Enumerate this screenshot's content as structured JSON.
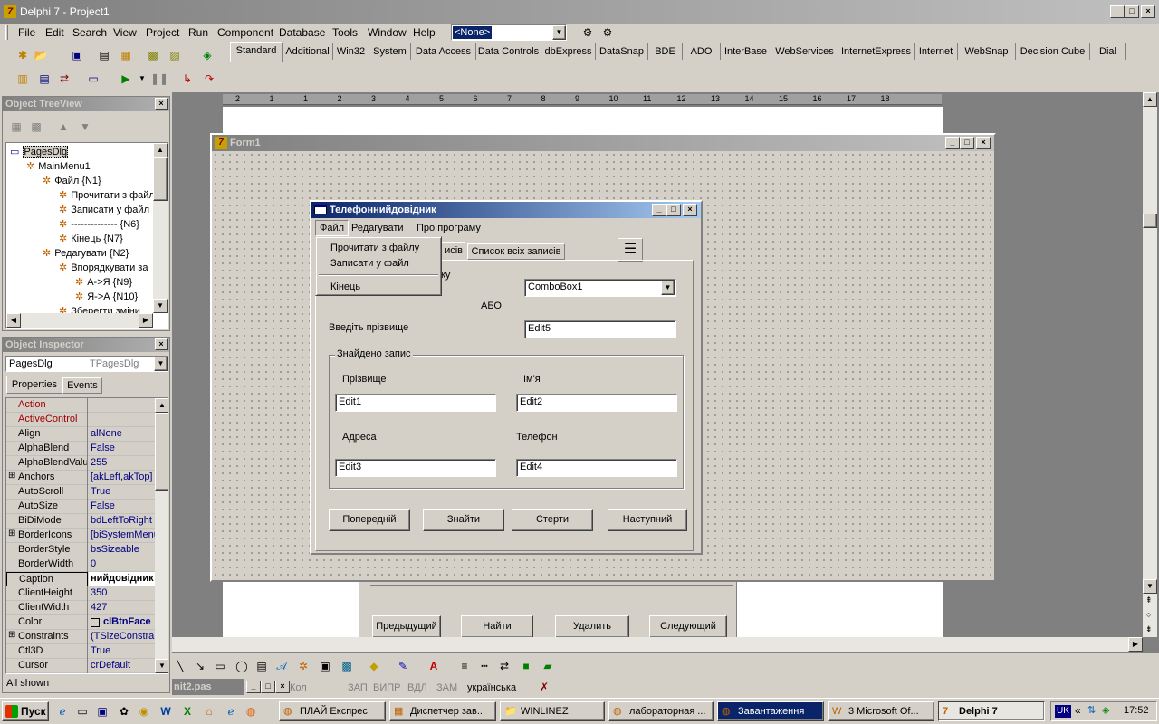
{
  "ide": {
    "title": "Delphi 7 - Project1",
    "menu": [
      "File",
      "Edit",
      "Search",
      "View",
      "Project",
      "Run",
      "Component",
      "Database",
      "Tools",
      "Window",
      "Help"
    ],
    "config_combo": "<None>",
    "palette_tabs": [
      "Standard",
      "Additional",
      "Win32",
      "System",
      "Data Access",
      "Data Controls",
      "dbExpress",
      "DataSnap",
      "BDE",
      "ADO",
      "InterBase",
      "WebServices",
      "InternetExpress",
      "Internet",
      "WebSnap",
      "Decision Cube",
      "Dial"
    ],
    "ruler_numbers": [
      "2",
      "1",
      "1",
      "2",
      "3",
      "4",
      "5",
      "6",
      "7",
      "8",
      "9",
      "10",
      "11",
      "12",
      "13",
      "14",
      "15",
      "16",
      "17",
      "18"
    ]
  },
  "treeview": {
    "title": "Object TreeView",
    "items": [
      {
        "label": "PagesDlg",
        "level": 0
      },
      {
        "label": "MainMenu1",
        "level": 1
      },
      {
        "label": "Файл {N1}",
        "level": 2
      },
      {
        "label": "Прочитати з файл",
        "level": 3
      },
      {
        "label": "Записати у файл",
        "level": 3
      },
      {
        "label": "-------------- {N6}",
        "level": 3
      },
      {
        "label": "Кінець {N7}",
        "level": 3
      },
      {
        "label": "Редагувати {N2}",
        "level": 2
      },
      {
        "label": "Впорядкувати за",
        "level": 3
      },
      {
        "label": "А->Я {N9}",
        "level": 4
      },
      {
        "label": "Я->А {N10}",
        "level": 4
      },
      {
        "label": "Зберегти зміни",
        "level": 3
      }
    ]
  },
  "inspector": {
    "title": "Object Inspector",
    "object_name": "PagesDlg",
    "object_type": "TPagesDlg",
    "tabs": [
      "Properties",
      "Events"
    ],
    "status": "All shown",
    "props": [
      {
        "name": "Action",
        "value": "",
        "red": true
      },
      {
        "name": "ActiveControl",
        "value": "",
        "red": true
      },
      {
        "name": "Align",
        "value": "alNone"
      },
      {
        "name": "AlphaBlend",
        "value": "False"
      },
      {
        "name": "AlphaBlendValu",
        "value": "255"
      },
      {
        "name": "Anchors",
        "value": "[akLeft,akTop]",
        "plus": true
      },
      {
        "name": "AutoScroll",
        "value": "True"
      },
      {
        "name": "AutoSize",
        "value": "False"
      },
      {
        "name": "BiDiMode",
        "value": "bdLeftToRight"
      },
      {
        "name": "BorderIcons",
        "value": "[biSystemMenu,",
        "plus": true
      },
      {
        "name": "BorderStyle",
        "value": "bsSizeable"
      },
      {
        "name": "BorderWidth",
        "value": "0"
      },
      {
        "name": "Caption",
        "value": "нийдовідник",
        "selected": true
      },
      {
        "name": "ClientHeight",
        "value": "350"
      },
      {
        "name": "ClientWidth",
        "value": "427"
      },
      {
        "name": "Color",
        "value": "clBtnFace",
        "bold": true
      },
      {
        "name": "Constraints",
        "value": "(TSizeConstraint",
        "plus": true
      },
      {
        "name": "Ctl3D",
        "value": "True"
      },
      {
        "name": "Cursor",
        "value": "crDefault"
      }
    ]
  },
  "form1": {
    "title": "Form1"
  },
  "dialog": {
    "title": "Телефоннийдовідник",
    "menu": [
      "Файл",
      "Редагувати",
      "Про програму"
    ],
    "file_menu": [
      "Прочитати з файлу",
      "Записати у файл",
      "Кінець"
    ],
    "tabs": [
      "исів",
      "Список всіх записів"
    ],
    "partial_label": "ку",
    "combo": "ComboBox1",
    "or_label": "АБО",
    "surname_prompt": "Введіть прізвище",
    "edit5": "Edit5",
    "group_title": "Знайдено запис",
    "lbl_surname": "Прізвище",
    "lbl_name": "Ім'я",
    "edit1": "Edit1",
    "edit2": "Edit2",
    "lbl_address": "Адреса",
    "lbl_phone": "Телефон",
    "edit3": "Edit3",
    "edit4": "Edit4",
    "buttons": [
      "Попередній",
      "Знайти",
      "Стерти",
      "Наступний"
    ]
  },
  "background_form": {
    "buttons": [
      "Предыдущий",
      "Найти",
      "Удалить",
      "Следующий"
    ]
  },
  "editor_status": {
    "tab": "nit2.pas",
    "col": "Кол",
    "items": [
      "ЗАП",
      "ВИПР",
      "ВДЛ",
      "ЗАМ",
      "українська"
    ]
  },
  "taskbar": {
    "start": "Пуск",
    "tasks": [
      "ПЛАЙ Експрес",
      "Диспетчер зав...",
      "WINLINEZ",
      "лабораторная ...",
      "Завантаження",
      "3 Microsoft Of...",
      "Delphi 7"
    ],
    "lang": "UK",
    "time": "17:52"
  }
}
